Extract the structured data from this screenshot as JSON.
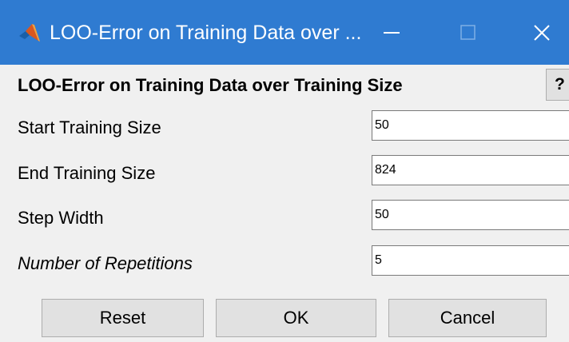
{
  "window": {
    "title": "LOO-Error on Training Data over ...",
    "app_icon": "matlab-logo-icon",
    "controls": [
      "minimize-icon",
      "maximize-icon",
      "close-icon"
    ],
    "titlebar_color": "#2f7bd1"
  },
  "dialog": {
    "heading": "LOO-Error on Training Data over Training Size",
    "help_label": "?",
    "fields": [
      {
        "label": "Start Training Size",
        "value": "50",
        "italic": false
      },
      {
        "label": "End Training Size",
        "value": "824",
        "italic": false
      },
      {
        "label": "Step Width",
        "value": "50",
        "italic": false
      },
      {
        "label": "Number of Repetitions",
        "value": "5",
        "italic": true
      }
    ],
    "buttons": {
      "reset": "Reset",
      "ok": "OK",
      "cancel": "Cancel"
    }
  }
}
